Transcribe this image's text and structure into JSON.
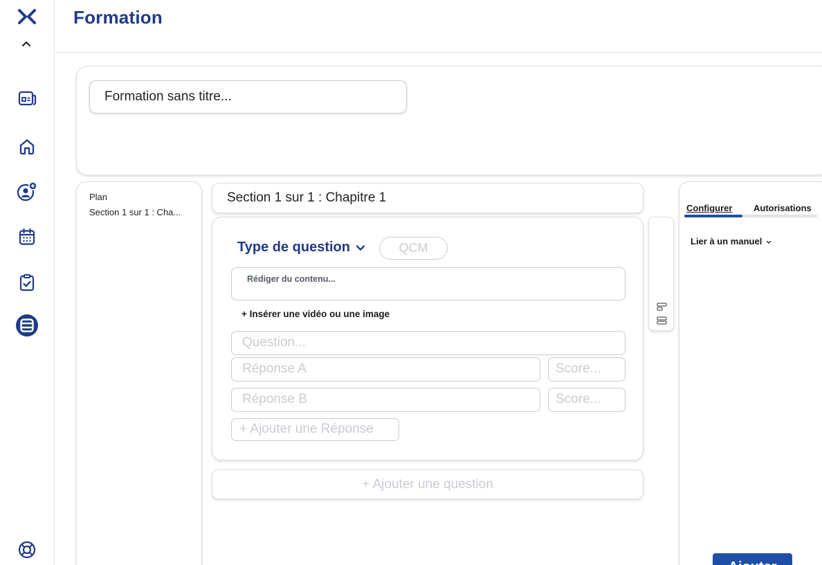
{
  "app": {
    "page_title": "Formation"
  },
  "sidebar": {
    "icons": [
      "newspaper-icon",
      "home-icon",
      "user-add-icon",
      "calendar-icon",
      "clipboard-check-icon",
      "training-icon",
      "help-lifebuoy-icon"
    ]
  },
  "training": {
    "title_value": "Formation sans titre..."
  },
  "plan": {
    "title": "Plan",
    "items": [
      "Section 1 sur 1 : Cha..."
    ]
  },
  "section": {
    "title": "Section 1 sur 1 : Chapitre 1"
  },
  "question": {
    "type_label": "Type de question",
    "type_value": "QCM",
    "content_placeholder": "Rédiger du contenu...",
    "insert_media": "+ Insérer une vidéo ou une image",
    "question_placeholder": "Question...",
    "answers": [
      {
        "placeholder": "Réponse A",
        "score_placeholder": "Score..."
      },
      {
        "placeholder": "Réponse B",
        "score_placeholder": "Score..."
      }
    ],
    "add_answer": "+ Ajouter une Réponse"
  },
  "add_question": "+ Ajouter une question",
  "config": {
    "tabs": [
      {
        "label": "Configurer",
        "active": true
      },
      {
        "label": "Autorisations",
        "active": false
      }
    ],
    "link_manual": "Lier à un manuel",
    "submit_label": "Ajouter"
  },
  "colors": {
    "brand": "#1f3a8a",
    "accent": "#1e4fa8",
    "placeholder": "#c9ccd2"
  }
}
